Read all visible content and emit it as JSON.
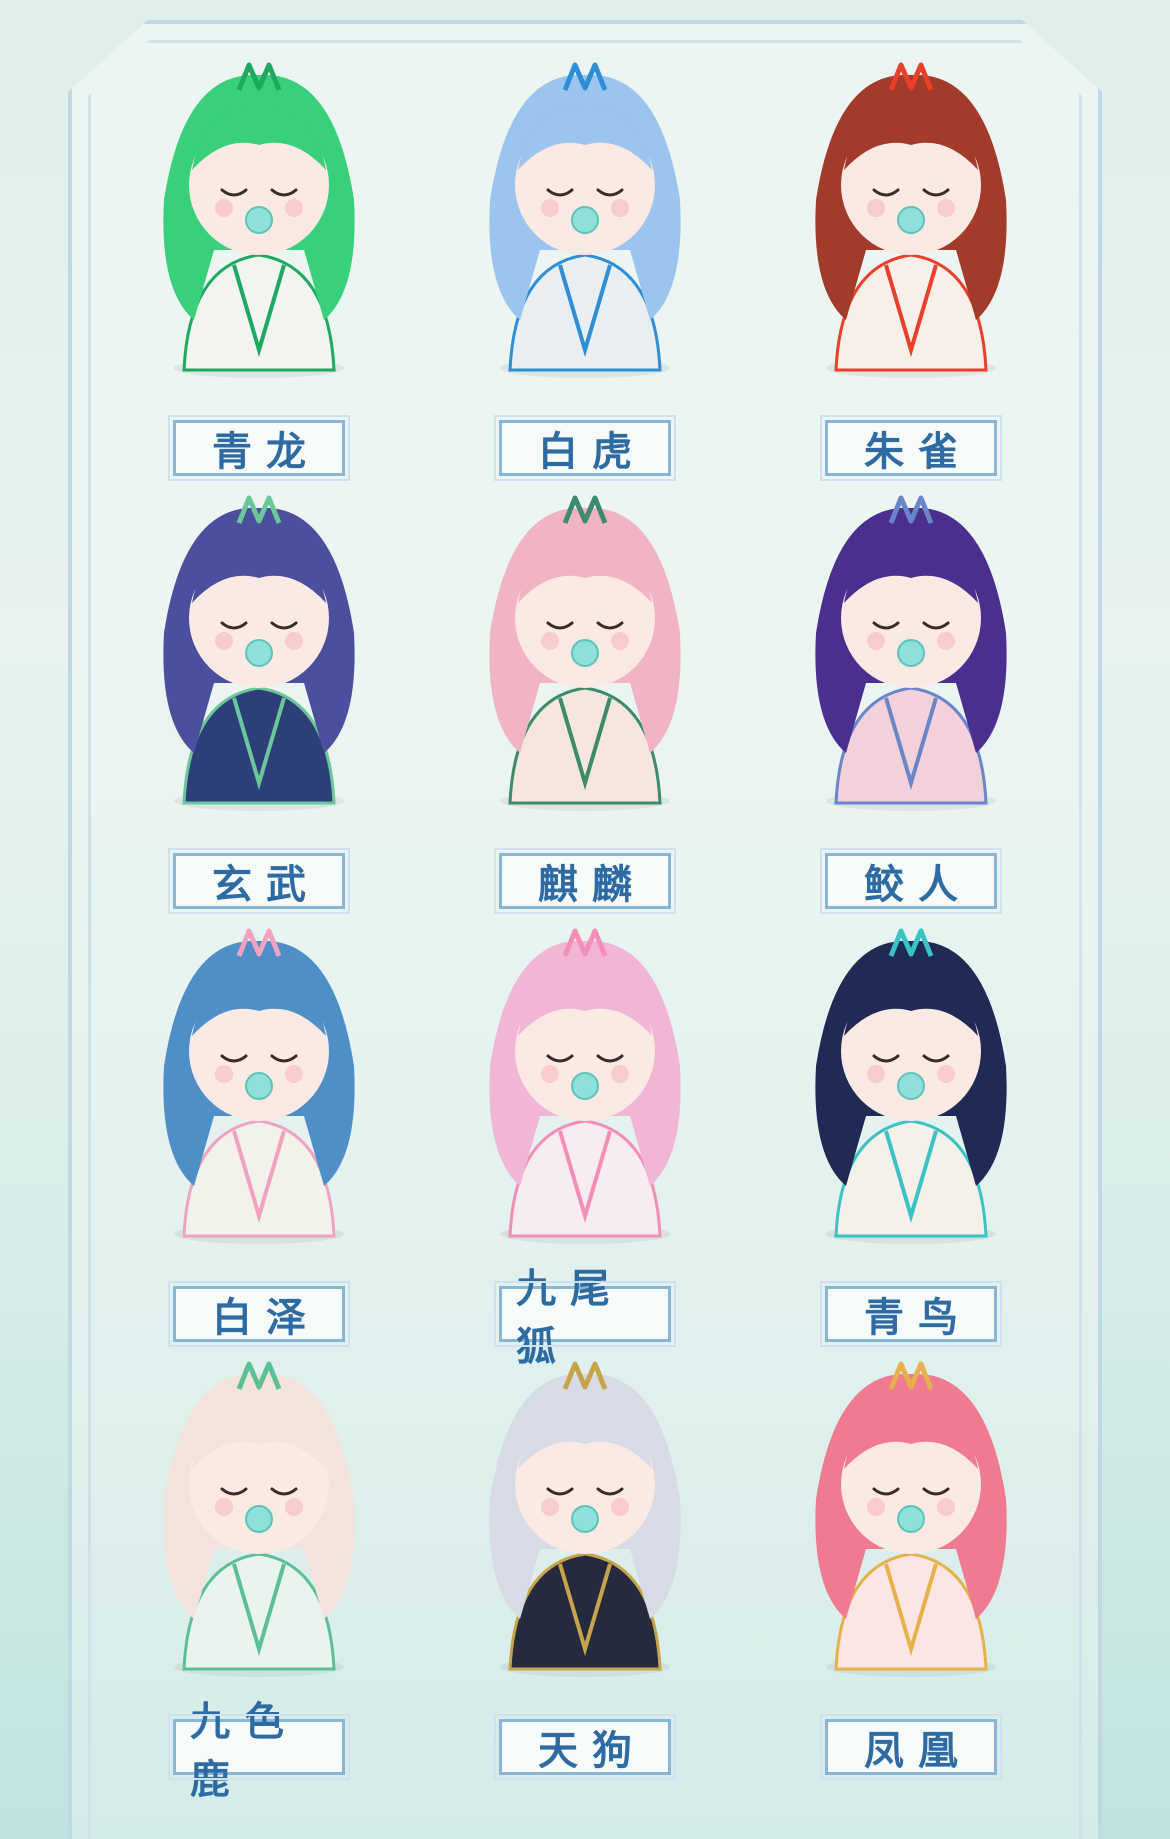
{
  "figures": [
    {
      "name": "青龙",
      "palette": {
        "hair": "#38d07a",
        "body": "#f1f4ef",
        "accent": "#1ea861"
      }
    },
    {
      "name": "白虎",
      "palette": {
        "hair": "#9bc4ee",
        "body": "#e9eef3",
        "accent": "#2f8ed4"
      }
    },
    {
      "name": "朱雀",
      "palette": {
        "hair": "#a33b2b",
        "body": "#f7efe8",
        "accent": "#ea3f2a"
      }
    },
    {
      "name": "玄武",
      "palette": {
        "hair": "#4b4f9e",
        "body": "#2d3f78",
        "accent": "#6bc79a"
      }
    },
    {
      "name": "麒麟",
      "palette": {
        "hair": "#f1b4c4",
        "body": "#f6e6de",
        "accent": "#3d8a6e"
      }
    },
    {
      "name": "鲛人",
      "palette": {
        "hair": "#4b2f8e",
        "body": "#f2d1da",
        "accent": "#6a86c8"
      }
    },
    {
      "name": "白泽",
      "palette": {
        "hair": "#4f8fc8",
        "body": "#f2f2ea",
        "accent": "#f0a2c1"
      }
    },
    {
      "name": "九尾狐",
      "palette": {
        "hair": "#f1b6d6",
        "body": "#f7ecef",
        "accent": "#f38eb6"
      }
    },
    {
      "name": "青鸟",
      "palette": {
        "hair": "#202a55",
        "body": "#f6f0ea",
        "accent": "#3bc2c2"
      }
    },
    {
      "name": "九色鹿",
      "palette": {
        "hair": "#f4e3dc",
        "body": "#eaf4ef",
        "accent": "#5dbf98"
      }
    },
    {
      "name": "天狗",
      "palette": {
        "hair": "#d8dbe6",
        "body": "#252a3e",
        "accent": "#c6a54a"
      }
    },
    {
      "name": "凤凰",
      "palette": {
        "hair": "#f07b91",
        "body": "#fbe6e5",
        "accent": "#e6b14a"
      }
    }
  ]
}
